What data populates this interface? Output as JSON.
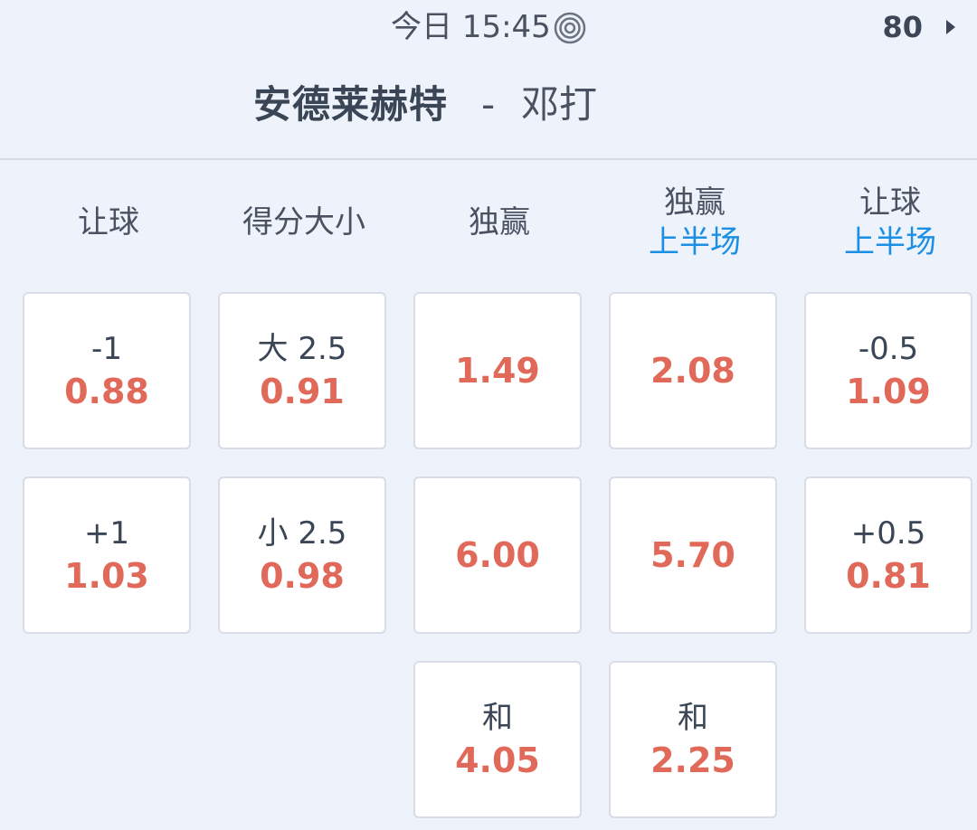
{
  "header": {
    "time": "今日 15:45",
    "market_count": "80",
    "home_team": "安德莱赫特",
    "separator": "-",
    "away_team": "邓打"
  },
  "columns": [
    {
      "title": "让球",
      "subtitle": ""
    },
    {
      "title": "得分大小",
      "subtitle": ""
    },
    {
      "title": "独赢",
      "subtitle": ""
    },
    {
      "title": "独赢",
      "subtitle": "上半场"
    },
    {
      "title": "让球",
      "subtitle": "上半场"
    }
  ],
  "cells": {
    "handicap_home": {
      "line": "-1",
      "odds": "0.88"
    },
    "handicap_away": {
      "line": "+1",
      "odds": "1.03"
    },
    "total_over": {
      "line": "大 2.5",
      "odds": "0.91"
    },
    "total_under": {
      "line": "小 2.5",
      "odds": "0.98"
    },
    "moneyline_home": {
      "odds": "1.49"
    },
    "moneyline_away": {
      "odds": "6.00"
    },
    "moneyline_draw": {
      "line": "和",
      "odds": "4.05"
    },
    "h1_moneyline_home": {
      "odds": "2.08"
    },
    "h1_moneyline_away": {
      "odds": "5.70"
    },
    "h1_moneyline_draw": {
      "line": "和",
      "odds": "2.25"
    },
    "h1_handicap_home": {
      "line": "-0.5",
      "odds": "1.09"
    },
    "h1_handicap_away": {
      "line": "+0.5",
      "odds": "0.81"
    }
  },
  "icons": {
    "live": "live-target-icon",
    "more": "chevron-right-icon"
  },
  "colors": {
    "background": "#eef2fb",
    "odds": "#e0695a",
    "subtitle_accent": "#1a8fe3",
    "text": "#3a4556"
  }
}
